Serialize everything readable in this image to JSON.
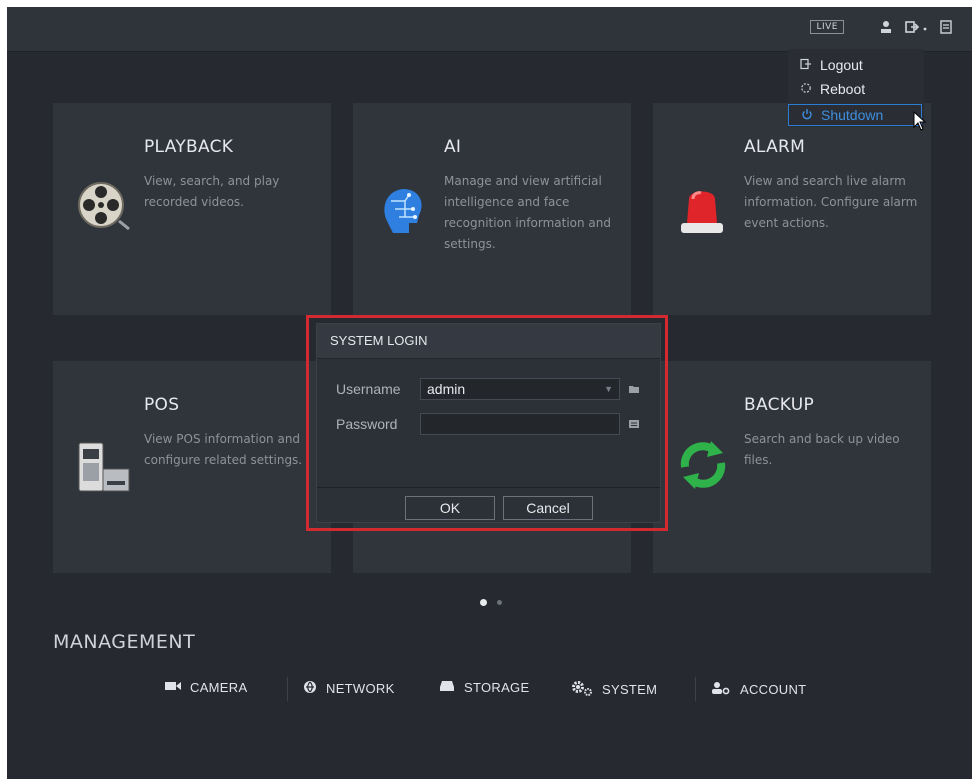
{
  "topbar": {
    "live_label": "LIVE",
    "icons": [
      "user-icon",
      "logout-icon",
      "chevron-down-icon",
      "screen-icon"
    ]
  },
  "menu": {
    "items": [
      {
        "label": "Logout",
        "icon": "logout-icon"
      },
      {
        "label": "Reboot",
        "icon": "reboot-icon"
      },
      {
        "label": "Shutdown",
        "icon": "power-icon",
        "selected": true
      }
    ]
  },
  "tiles": [
    {
      "title": "PLAYBACK",
      "desc": "View, search, and play recorded videos.",
      "icon": "film-reel-icon"
    },
    {
      "title": "AI",
      "desc": "Manage and view artificial intelligence and face recognition information and settings.",
      "icon": "ai-head-icon"
    },
    {
      "title": "ALARM",
      "desc": "View and search live alarm information. Configure alarm event actions.",
      "icon": "alarm-light-icon"
    },
    {
      "title": "POS",
      "desc": "View POS information and configure related settings.",
      "icon": "pos-terminal-icon"
    },
    {
      "title": "BACKUP",
      "desc": "Search and back up video files.",
      "icon": "sync-icon"
    }
  ],
  "dialog": {
    "title": "SYSTEM LOGIN",
    "username_label": "Username",
    "username_value": "admin",
    "password_label": "Password",
    "password_value": "",
    "ok_label": "OK",
    "cancel_label": "Cancel"
  },
  "pager": {
    "total": 2,
    "active": 1
  },
  "management": {
    "title": "MANAGEMENT",
    "items": [
      {
        "label": "CAMERA",
        "icon": "camera-icon"
      },
      {
        "label": "NETWORK",
        "icon": "network-icon"
      },
      {
        "label": "STORAGE",
        "icon": "storage-icon"
      },
      {
        "label": "SYSTEM",
        "icon": "gear-icon"
      },
      {
        "label": "ACCOUNT",
        "icon": "account-icon"
      }
    ]
  },
  "colors": {
    "accent": "#2b7ed6",
    "highlight_outline": "#d22a2e",
    "background": "#262a30",
    "tile": "#30343b"
  }
}
